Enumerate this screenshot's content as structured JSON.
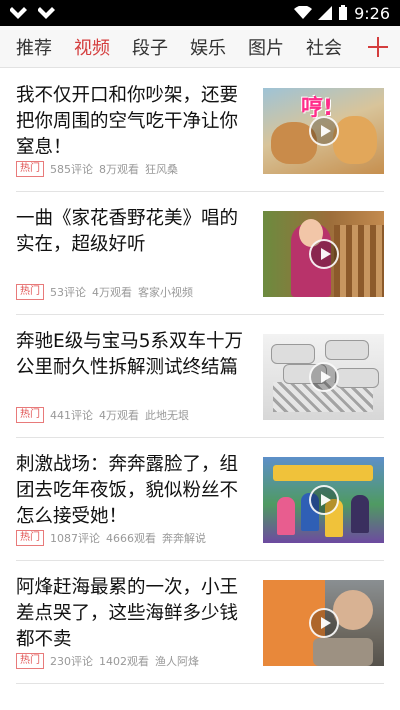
{
  "status_bar": {
    "time": "9:26"
  },
  "tabs": [
    {
      "label": "推荐",
      "active": false
    },
    {
      "label": "视频",
      "active": true
    },
    {
      "label": "段子",
      "active": false
    },
    {
      "label": "娱乐",
      "active": false
    },
    {
      "label": "图片",
      "active": false
    },
    {
      "label": "社会",
      "active": false
    }
  ],
  "colors": {
    "accent": "#d43d3d",
    "tag_border": "#e87a7a",
    "meta_gray": "#999999"
  },
  "feed": [
    {
      "title": "我不仅开口和你吵架，还要把你周围的空气吃干净让你窒息！",
      "tag": "热门",
      "comments": "585评论",
      "views": "8万观看",
      "source": "狂风桑",
      "thumb_text": "哼!"
    },
    {
      "title": "一曲《家花香野花美》唱的实在，超级好听",
      "tag": "热门",
      "comments": "53评论",
      "views": "4万观看",
      "source": "客家小视频"
    },
    {
      "title": "奔驰E级与宝马5系双车十万公里耐久性拆解测试终结篇",
      "tag": "热门",
      "comments": "441评论",
      "views": "4万观看",
      "source": "此地无垠"
    },
    {
      "title": "刺激战场：奔奔露脸了，组团去吃年夜饭，貌似粉丝不怎么接受她！",
      "tag": "热门",
      "comments": "1087评论",
      "views": "4666观看",
      "source": "奔奔解说"
    },
    {
      "title": "阿烽赶海最累的一次，小王差点哭了，这些海鲜多少钱都不卖",
      "tag": "热门",
      "comments": "230评论",
      "views": "1402观看",
      "source": "渔人阿烽"
    }
  ]
}
